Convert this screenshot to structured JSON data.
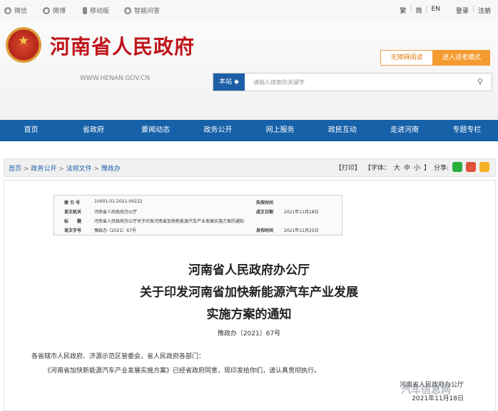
{
  "topbar": {
    "links": [
      {
        "icon": "weibo-icon",
        "label": "微信"
      },
      {
        "icon": "weibo-icon",
        "label": "微博"
      },
      {
        "icon": "mobile-icon",
        "label": "移动版"
      },
      {
        "icon": "q-and-a-icon",
        "label": "智能问答"
      }
    ],
    "lang": [
      "繁",
      "简",
      "EN"
    ],
    "login": "登录",
    "register": "注册"
  },
  "header": {
    "title": "河南省人民政府",
    "domain": "WWW.HENAN.GOV.CN",
    "accessible": "无障碍阅读",
    "elder": "进入适老模式",
    "search_scope": "本站",
    "search_placeholder": "请输入搜索的关键字"
  },
  "nav": [
    "首页",
    "省政府",
    "要闻动态",
    "政务公开",
    "网上服务",
    "政民互动",
    "走进河南",
    "专题专栏"
  ],
  "breadcrumb": {
    "items": [
      "首页",
      "政务公开",
      "法规文件",
      "豫政办"
    ],
    "print": "【打印】",
    "font": "【字体：",
    "large": "大",
    "medium": "中",
    "small": "小",
    "font_end": "】",
    "share": "分享:"
  },
  "meta": {
    "idx_k": "索 引 号",
    "idx_v": "10001-01-2021-00222",
    "valid_k": "失效时间",
    "valid_v": "",
    "org_k": "发文机关",
    "org_v": "河南省人民政府办公厅",
    "date_k": "成文日期",
    "date_v": "2021年11月18日",
    "title_k": "标　　题",
    "title_v": "河南省人民政府办公厅关于印发河南省加快新能源汽车产业发展实施方案的通知",
    "no_k": "发文字号",
    "no_v": "豫政办〔2021〕67号",
    "pub_k": "发布时间",
    "pub_v": "2021年11月25日"
  },
  "doc": {
    "title1": "河南省人民政府办公厅",
    "title2": "关于印发河南省加快新能源汽车产业发展",
    "title3": "实施方案的通知",
    "number": "豫政办〔2021〕67号",
    "addressee": "各省辖市人民政府、济源示范区管委会，省人民政府各部门：",
    "body": "《河南省加快新能源汽车产业发展实施方案》已经省政府同意，现印发给你们，请认真贯彻执行。",
    "signer": "河南省人民政府办公厅",
    "date": "2021年11月18日"
  },
  "watermark": "汽车信息网",
  "colors": {
    "nav": "#1661a8",
    "title": "#c0141b",
    "orange": "#f59a2f"
  }
}
